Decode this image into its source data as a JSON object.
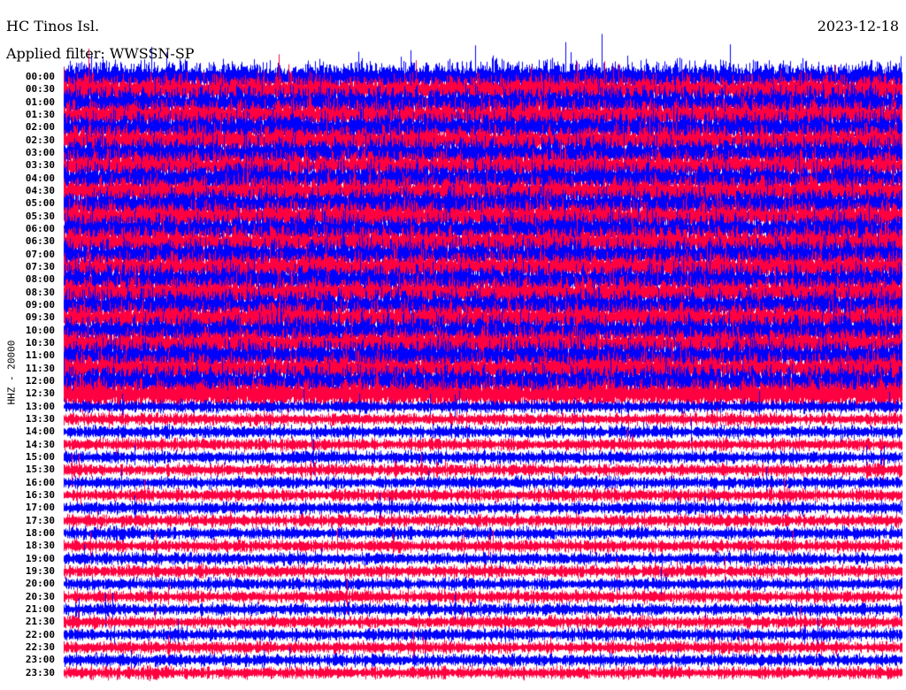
{
  "header": {
    "station": "HC Tinos Isl.",
    "date": "2023-12-18",
    "filter": "Applied filter: WWSSN-SP"
  },
  "chart_data": {
    "type": "line",
    "title": "HC Tinos Isl.",
    "subtitle": "Applied filter: WWSSN-SP",
    "ylabel": "HHZ - 20000",
    "channel": "HHZ - 20000",
    "date": "2023-12-18",
    "row_labels": [
      "00:00",
      "00:30",
      "01:00",
      "01:30",
      "02:00",
      "02:30",
      "03:00",
      "03:30",
      "04:00",
      "04:30",
      "05:00",
      "05:30",
      "06:00",
      "06:30",
      "07:00",
      "07:30",
      "08:00",
      "08:30",
      "09:00",
      "09:30",
      "10:00",
      "10:30",
      "11:00",
      "11:30",
      "12:00",
      "12:30",
      "13:00",
      "13:30",
      "14:00",
      "14:30",
      "15:00",
      "15:30",
      "16:00",
      "16:30",
      "17:00",
      "17:30",
      "18:00",
      "18:30",
      "19:00",
      "19:30",
      "20:00",
      "20:30",
      "21:00",
      "21:30",
      "22:00",
      "22:30",
      "23:00",
      "23:30"
    ],
    "row_colors": [
      "#0000ff",
      "#ff0040"
    ],
    "relative_amplitude_day": 2.2,
    "relative_amplitude_night": 0.9,
    "grid": false
  }
}
